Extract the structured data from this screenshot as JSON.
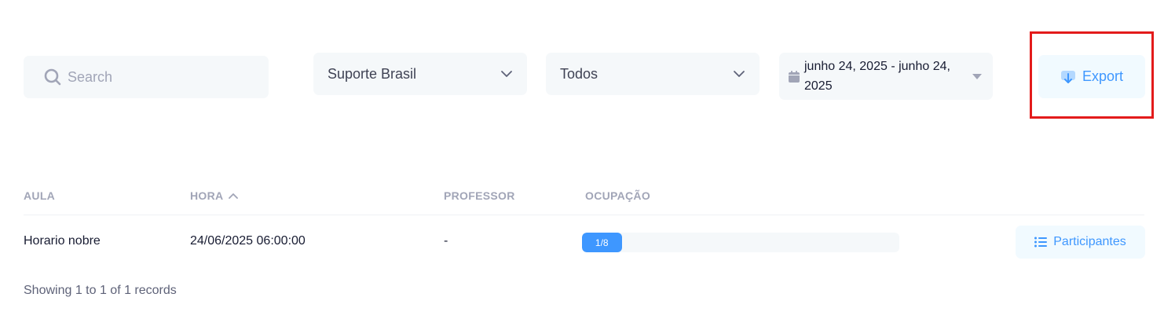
{
  "filters": {
    "search_placeholder": "Search",
    "search_icon": "search-icon",
    "group_select": "Suporte Brasil",
    "status_select": "Todos",
    "date_range": "junho 24, 2025 - junho 24, 2025",
    "export_label": "Export"
  },
  "table": {
    "headers": {
      "aula": "AULA",
      "hora": "HORA",
      "professor": "PROFESSOR",
      "ocupacao": "OCUPAÇÃO"
    },
    "rows": [
      {
        "aula": "Horario nobre",
        "hora": "24/06/2025 06:00:00",
        "professor": "-",
        "ocupacao_label": "1/8",
        "ocupacao_fraction": 0.125,
        "action_label": "Participantes"
      }
    ]
  },
  "footer": {
    "records_text": "Showing 1 to 1 of 1 records"
  },
  "colors": {
    "accent": "#3e97ff",
    "highlight": "#e31b1b"
  }
}
